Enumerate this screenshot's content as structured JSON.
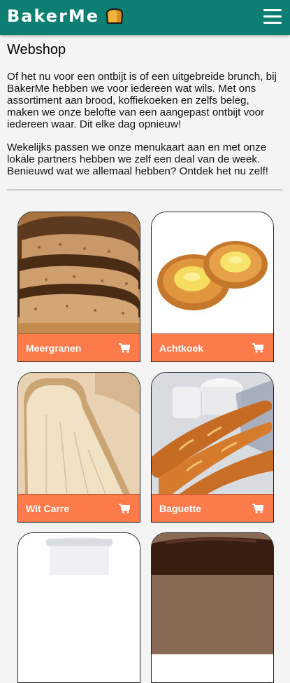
{
  "header": {
    "brand": "BakerMe",
    "brand_color": "#0d7f72",
    "logo_icon": "bread-icon",
    "menu_icon": "hamburger-menu-icon"
  },
  "page": {
    "title": "Webshop",
    "paragraphs": [
      "Of het nu voor een ontbijt is of een uitgebreide brunch, bij BakerMe hebben we voor iedereen wat wils. Met ons assortiment aan brood, koffiekoeken en zelfs beleg, maken we onze belofte van een aangepast ontbijt voor iedereen waar. Dit elke dag opnieuw!",
      "Wekelijks passen we onze menukaart aan en met onze lokale partners hebben we zelf een deal van de week. Benieuwd wat we allemaal hebben? Ontdek het nu zelf!"
    ]
  },
  "products": [
    {
      "name": "Meergranen",
      "image": "multigrain-bread-image",
      "cart_icon": "shopping-cart-icon"
    },
    {
      "name": "Achtkoek",
      "image": "custard-pastry-image",
      "cart_icon": "shopping-cart-icon"
    },
    {
      "name": "Wit Carre",
      "image": "white-bread-image",
      "cart_icon": "shopping-cart-icon"
    },
    {
      "name": "Baguette",
      "image": "baguette-image",
      "cart_icon": "shopping-cart-icon"
    },
    {
      "name": "",
      "image": "milk-jar-image"
    },
    {
      "name": "",
      "image": "chocolate-pastry-image"
    }
  ],
  "colors": {
    "accent": "#fd7a4b",
    "background": "#f4f4f4"
  }
}
